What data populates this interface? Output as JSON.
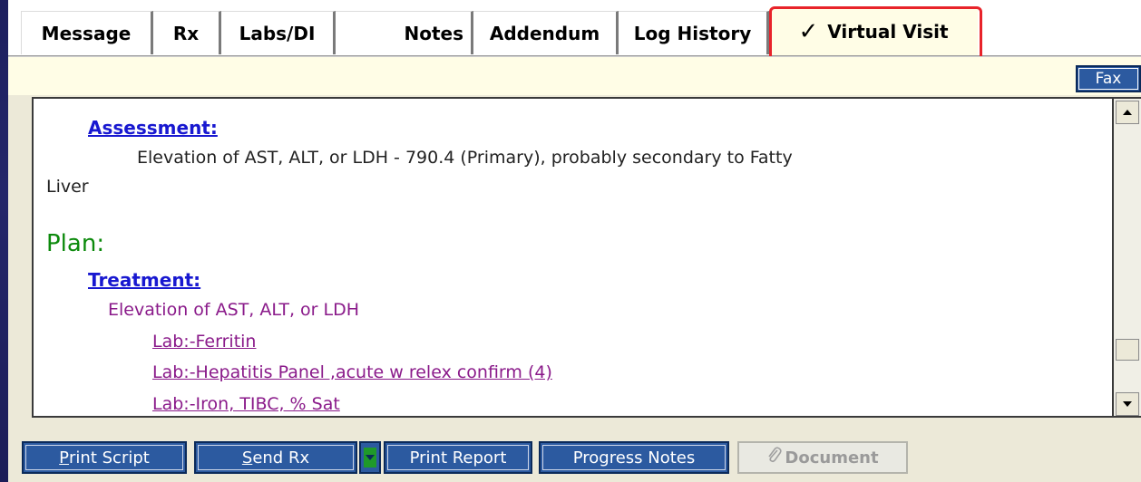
{
  "tabs": [
    {
      "label": "Message"
    },
    {
      "label": "Rx"
    },
    {
      "label": "Labs/DI"
    },
    {
      "label": "Notes"
    },
    {
      "label": "Addendum"
    },
    {
      "label": "Log History"
    }
  ],
  "active_tab": {
    "label": "Virtual Visit",
    "checkmark": "✓"
  },
  "toolbar": {
    "fax_label": "Fax"
  },
  "note": {
    "assessment_heading": "Assessment:",
    "assessment_line1": "Elevation of AST, ALT, or LDH - 790.4 (Primary), probably secondary to Fatty",
    "assessment_line2": "Liver",
    "plan_heading": "Plan:",
    "treatment_heading": "Treatment:",
    "treatment_item": "Elevation of AST, ALT, or LDH",
    "orders": [
      "Lab:-Ferritin",
      "Lab:-Hepatitis Panel ,acute w relex confirm (4)",
      "Lab:-Iron, TIBC, % Sat"
    ]
  },
  "buttons": {
    "print_script": {
      "mnemonic": "P",
      "rest": "rint Script"
    },
    "send_rx": {
      "mnemonic": "S",
      "rest": "end Rx"
    },
    "print_report": "Print Report",
    "progress_notes": "Progress Notes",
    "document": "Document"
  },
  "icons": {
    "checkmark": "checkmark-icon",
    "scroll_up": "scroll-up-arrow-icon",
    "scroll_down": "scroll-down-arrow-icon",
    "dropdown": "dropdown-arrow-icon",
    "paperclip": "paperclip-icon"
  },
  "colors": {
    "accent_button": "#2c5aa0",
    "highlight_border": "#e8232a",
    "heading_link": "#1818d0",
    "plan_green": "#0c8a0c",
    "order_purple": "#8a1a8a"
  }
}
